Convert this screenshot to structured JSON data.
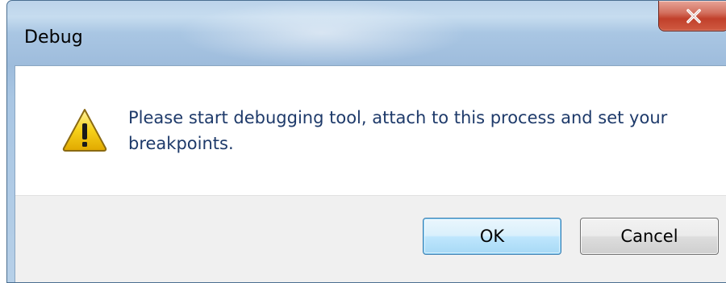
{
  "dialog": {
    "title": "Debug",
    "message": "Please start debugging tool, attach to this process and set your breakpoints.",
    "icon": "warning-icon",
    "buttons": {
      "ok_label": "OK",
      "cancel_label": "Cancel"
    },
    "close_icon": "close-icon"
  },
  "colors": {
    "title_frame": "#a9c6e3",
    "close_button": "#c1402b",
    "message_text": "#1e3a6a",
    "button_area": "#f0f0f0",
    "default_button_border": "#3c7fb1",
    "warning_yellow": "#f7d21a"
  }
}
